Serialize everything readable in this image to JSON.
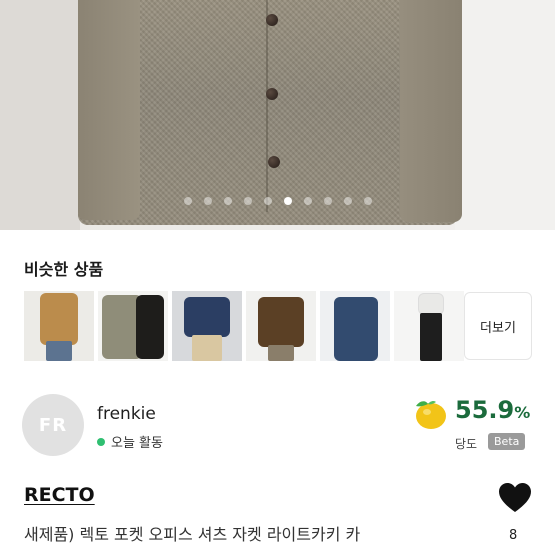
{
  "hero": {
    "image_alt": "상품 이미지",
    "carousel_dots": 10,
    "active_dot": 6
  },
  "similar": {
    "title": "비슷한 상품",
    "more_label": "더보기",
    "items": [
      {
        "name": "similar-item-1",
        "color": "#b88a4a"
      },
      {
        "name": "similar-item-2",
        "color": "#8f8d78"
      },
      {
        "name": "similar-item-3",
        "color": "#2c3f63"
      },
      {
        "name": "similar-item-4",
        "color": "#5b4025"
      },
      {
        "name": "similar-item-5",
        "color": "#324b6f"
      },
      {
        "name": "similar-item-6",
        "color": "#1f1f1f"
      }
    ]
  },
  "seller": {
    "avatar_initials": "FR",
    "name": "frenkie",
    "activity": "오늘 활동",
    "score": "55.9",
    "score_unit": "%",
    "score_label": "당도",
    "beta": "Beta"
  },
  "product": {
    "brand": "RECTO",
    "title": "새제품) 렉토 포켓 오피스 셔츠 자켓 라이트카키 카",
    "likes": "8"
  },
  "colors": {
    "score_green": "#1b6b3c",
    "active_green": "#2fbf71",
    "lemon": "#f2c418"
  }
}
